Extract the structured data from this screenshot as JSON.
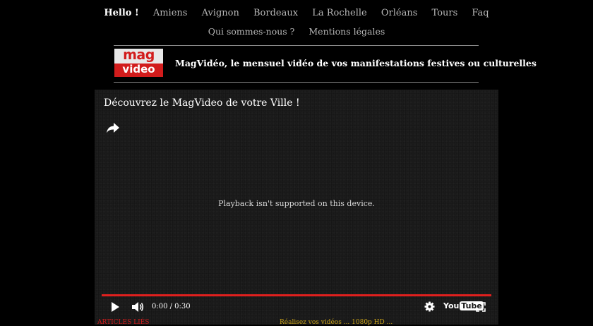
{
  "nav": {
    "row1": [
      "Hello !",
      "Amiens",
      "Avignon",
      "Bordeaux",
      "La Rochelle",
      "Orléans",
      "Tours",
      "Faq"
    ],
    "row2": [
      "Qui sommes-nous ?",
      "Mentions légales"
    ]
  },
  "logo": {
    "line1": "mag",
    "line2": "video"
  },
  "tagline": "MagVidéo, le mensuel vidéo de vos manifestations festives ou culturelles",
  "video": {
    "title": "Découvrez le MagVideo de votre Ville !",
    "message": "Playback isn't supported on this device.",
    "time": "0:00 / 0:30",
    "youtube_you": "You",
    "youtube_tube": "Tube"
  },
  "bottom": {
    "left": "ARTICLES LIÉS",
    "right": "Réalisez vos vidéos ... 1080p HD ..."
  },
  "colors": {
    "accent": "#d21c1c",
    "gold": "#c9a21a",
    "background": "#000000"
  },
  "icons": [
    "share-icon",
    "play-icon",
    "volume-icon",
    "gear-icon",
    "fullscreen-icon",
    "youtube-logo"
  ]
}
